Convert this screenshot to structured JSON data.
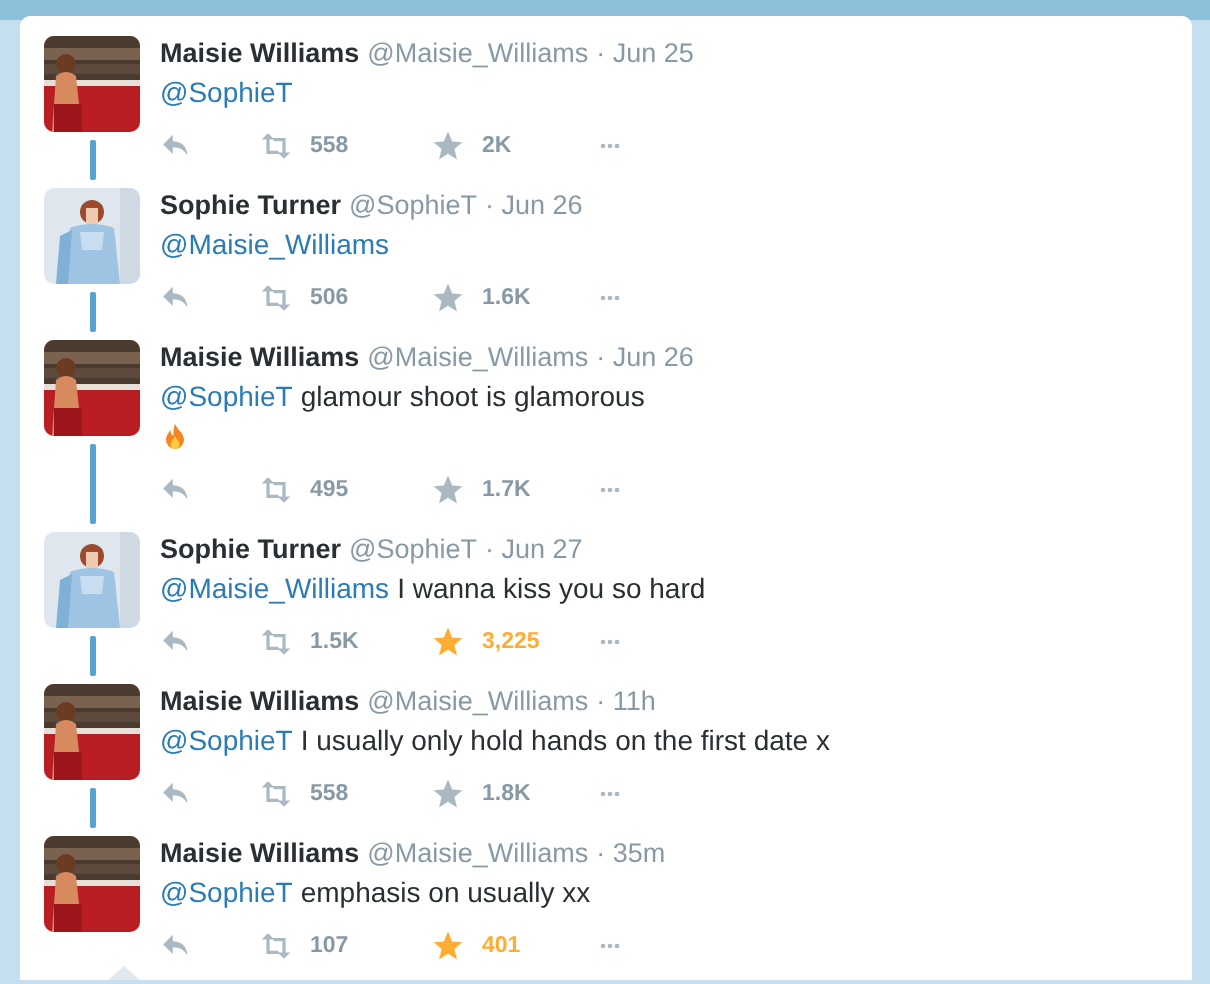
{
  "tweets": [
    {
      "name": "Maisie Williams",
      "handle": "@Maisie_Williams",
      "time": "· Jun 25",
      "mention": "@SophieT",
      "retweets": "558",
      "favorites": "2K",
      "favorited": false
    },
    {
      "name": "Sophie Turner",
      "handle": "@SophieT",
      "time": "· Jun 26",
      "mention": "@Maisie_Williams",
      "retweets": "506",
      "favorites": "1.6K",
      "favorited": false
    },
    {
      "name": "Maisie Williams",
      "handle": "@Maisie_Williams",
      "time": "· Jun 26",
      "mention": "@SophieT",
      "text": "glamour shoot is glamorous",
      "fire_icon": true,
      "retweets": "495",
      "favorites": "1.7K",
      "favorited": false
    },
    {
      "name": "Sophie Turner",
      "handle": "@SophieT",
      "time": "· Jun 27",
      "mention": "@Maisie_Williams",
      "text": "I wanna kiss you so hard",
      "retweets": "1.5K",
      "favorites": "3,225",
      "favorited": true
    },
    {
      "name": "Maisie Williams",
      "handle": "@Maisie_Williams",
      "time": "· 11h",
      "mention": "@SophieT",
      "text": "I usually only hold hands on the first date x",
      "retweets": "558",
      "favorites": "1.8K",
      "favorited": false
    },
    {
      "name": "Maisie Williams",
      "handle": "@Maisie_Williams",
      "time": "· 35m",
      "mention": "@SophieT",
      "text": "emphasis on usually xx",
      "retweets": "107",
      "favorites": "401",
      "favorited": true
    }
  ]
}
